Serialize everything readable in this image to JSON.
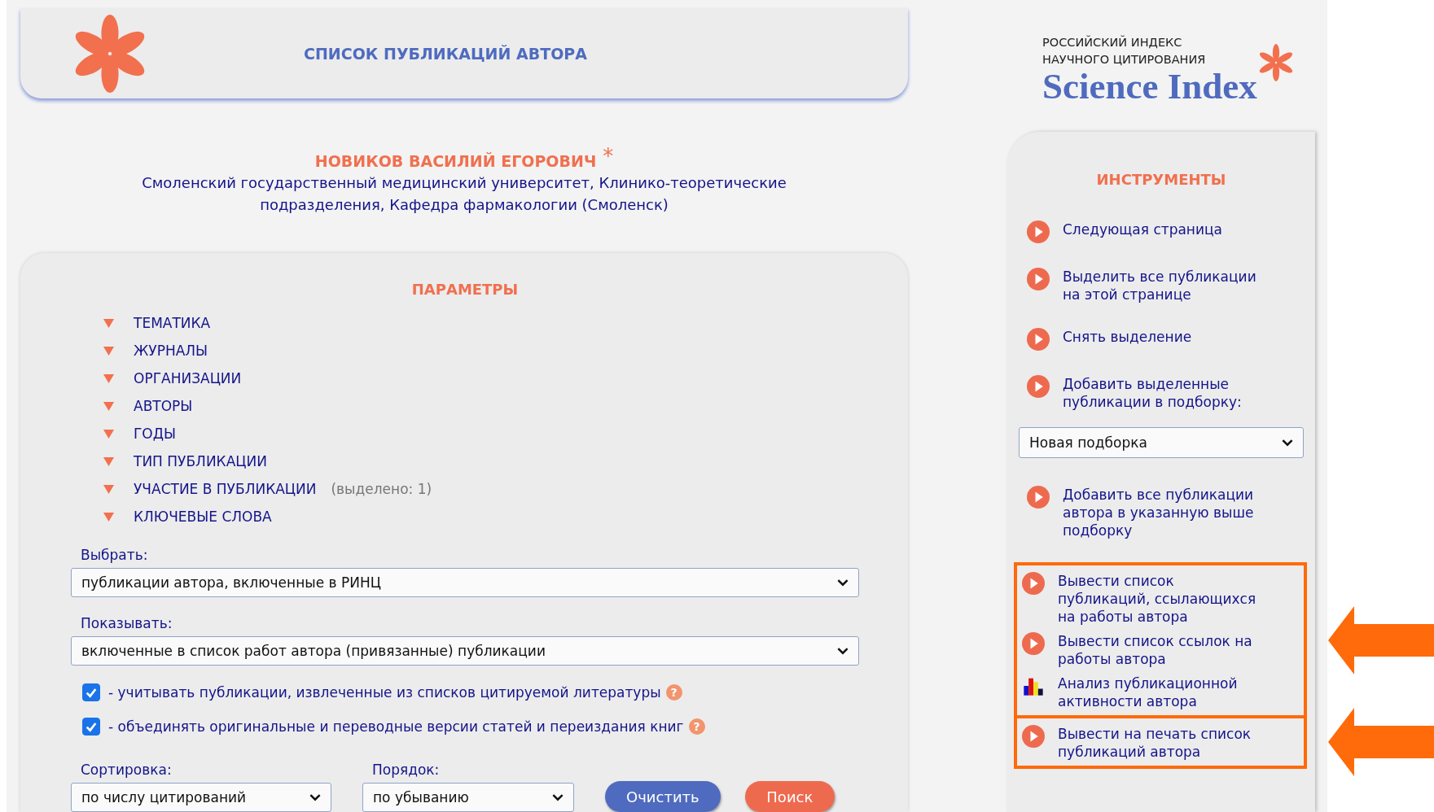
{
  "header": {
    "title": "СПИСОК ПУБЛИКАЦИЙ АВТОРА"
  },
  "logo": {
    "line_1": "РОССИЙСКИЙ ИНДЕКС",
    "line_2": "НАУЧНОГО ЦИТИРОВАНИЯ",
    "name": "Science Index"
  },
  "author": {
    "name": "НОВИКОВ ВАСИЛИЙ ЕГОРОВИЧ",
    "mark": "*",
    "affiliation": "Смоленский государственный медицинский университет, Клинико-теоретические подразделения, Кафедра фармакологии (Смоленск)"
  },
  "parameters": {
    "title": "ПАРАМЕТРЫ",
    "filters": [
      {
        "label": "ТЕМАТИКА"
      },
      {
        "label": "ЖУРНАЛЫ"
      },
      {
        "label": "ОРГАНИЗАЦИИ"
      },
      {
        "label": "АВТОРЫ"
      },
      {
        "label": "ГОДЫ"
      },
      {
        "label": "ТИП ПУБЛИКАЦИИ"
      },
      {
        "label": "УЧАСТИЕ В ПУБЛИКАЦИИ",
        "note": "(выделено: 1)"
      },
      {
        "label": "КЛЮЧЕВЫЕ СЛОВА"
      }
    ],
    "select_label": "Выбрать:",
    "select_value": "публикации автора, включенные в РИНЦ",
    "show_label": "Показывать:",
    "show_value": "включенные в список работ автора (привязанные) публикации",
    "options": [
      {
        "label": "- учитывать публикации, извлеченные из списков цитируемой литературы",
        "checked": true,
        "hint": "?"
      },
      {
        "label": "- объединять оригинальные и переводные версии статей и переиздания книг",
        "checked": true,
        "hint": "?"
      }
    ],
    "sort_label": "Сортировка:",
    "sort_value": "по числу цитирований",
    "order_label": "Порядок:",
    "order_value": "по убыванию",
    "buttons": [
      {
        "label": "Очистить",
        "kind": "secondary"
      },
      {
        "label": "Поиск",
        "kind": "primary"
      }
    ]
  },
  "tools": {
    "title": "ИНСТРУМЕНТЫ",
    "groups": [
      {
        "highlighted": false,
        "items": [
          {
            "kind": "link",
            "label": "Следующая страница"
          },
          {
            "kind": "link",
            "label": "Выделить все публикации на этой странице"
          },
          {
            "kind": "link",
            "label": "Снять выделение"
          },
          {
            "kind": "link",
            "label": "Добавить выделенные публикации в подборку:"
          },
          {
            "kind": "select",
            "label": "Новая подборка"
          },
          {
            "kind": "link",
            "label": "Добавить все публикации автора в указанную выше подборку"
          }
        ]
      },
      {
        "highlighted": true,
        "items": [
          {
            "kind": "link",
            "label": "Вывести список публикаций, ссылающихся на работы автора"
          },
          {
            "kind": "link",
            "label": "Вывести список ссылок на работы автора"
          },
          {
            "kind": "chart",
            "label": "Анализ публикационной активности автора"
          }
        ]
      },
      {
        "highlighted": true,
        "items": [
          {
            "kind": "link",
            "label": "Вывести на печать список публикаций автора"
          }
        ]
      }
    ]
  }
}
